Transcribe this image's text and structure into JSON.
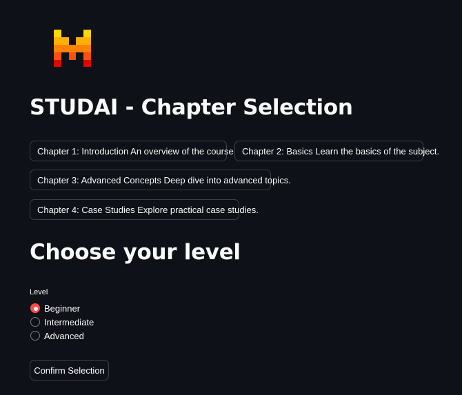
{
  "app": {
    "logo_icon": "pixel-m-logo",
    "brand_colors": [
      "#ffd700",
      "#ffaf00",
      "#ff8205",
      "#fa500f",
      "#e10500"
    ]
  },
  "header": {
    "title": "STUDAI - Chapter Selection"
  },
  "chapters": [
    {
      "label": "Chapter 1: Introduction An overview of the course."
    },
    {
      "label": "Chapter 2: Basics Learn the basics of the subject."
    },
    {
      "label": "Chapter 3: Advanced Concepts Deep dive into advanced topics."
    },
    {
      "label": "Chapter 4: Case Studies Explore practical case studies."
    }
  ],
  "level_section": {
    "title": "Choose your level",
    "label": "Level",
    "options": [
      "Beginner",
      "Intermediate",
      "Advanced"
    ],
    "selected": "Beginner",
    "accent_color": "#ff4b4b"
  },
  "actions": {
    "confirm_label": "Confirm Selection"
  }
}
